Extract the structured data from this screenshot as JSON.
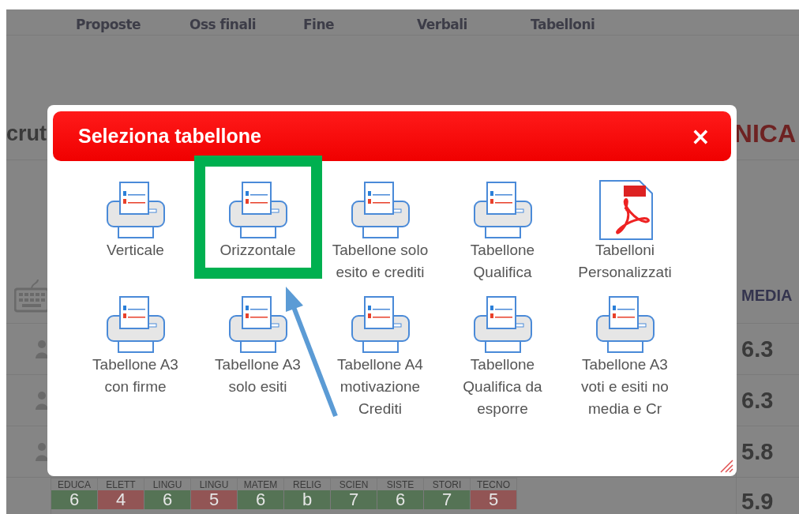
{
  "background": {
    "tabs": [
      {
        "label": "Proposte"
      },
      {
        "label": "Oss finali"
      },
      {
        "label": "Fine"
      },
      {
        "label": "Verbali"
      },
      {
        "label": "Tabelloni"
      }
    ],
    "title_left": "crut",
    "title_right": "NICA",
    "table": {
      "average_header": "MEDIA",
      "rows": [
        {
          "average": "6.3"
        },
        {
          "average": "6.3"
        },
        {
          "average": "5.8"
        }
      ],
      "last_row": {
        "average": "5.9",
        "grades": [
          {
            "subject": "EDUCA",
            "grade": "6",
            "color": "#557355"
          },
          {
            "subject": "ELETT",
            "grade": "4",
            "color": "#925555"
          },
          {
            "subject": "LINGU",
            "grade": "6",
            "color": "#557355"
          },
          {
            "subject": "LINGU",
            "grade": "5",
            "color": "#925555"
          },
          {
            "subject": "MATEM",
            "grade": "6",
            "color": "#557355"
          },
          {
            "subject": "RELIG",
            "grade": "b",
            "color": "#557355"
          },
          {
            "subject": "SCIEN",
            "grade": "7",
            "color": "#557355"
          },
          {
            "subject": "SISTE",
            "grade": "6",
            "color": "#557355"
          },
          {
            "subject": "STORI",
            "grade": "7",
            "color": "#557355"
          },
          {
            "subject": "TECNO",
            "grade": "5",
            "color": "#925555"
          }
        ]
      }
    }
  },
  "dialog": {
    "title": "Seleziona tabellone",
    "close": "×",
    "items": [
      {
        "label": "Verticale",
        "kind": "printer",
        "highlighted": false
      },
      {
        "label": "Orizzontale",
        "kind": "printer",
        "highlighted": true
      },
      {
        "label": "Tabellone solo esito e crediti",
        "kind": "printer",
        "highlighted": false
      },
      {
        "label": "Tabellone Qualifica",
        "kind": "printer",
        "highlighted": false
      },
      {
        "label": "Tabelloni Personalizzati",
        "kind": "pdf",
        "highlighted": false
      },
      {
        "label": "Tabellone A3 con firme",
        "kind": "printer",
        "highlighted": false
      },
      {
        "label": "Tabellone A3 solo esiti",
        "kind": "printer",
        "highlighted": false
      },
      {
        "label": "Tabellone A4 motivazione Crediti",
        "kind": "printer",
        "highlighted": false
      },
      {
        "label": "Tabellone Qualifica da esporre",
        "kind": "printer",
        "highlighted": false
      },
      {
        "label": "Tabellone A3 voti e esiti no media e Cr",
        "kind": "printer",
        "highlighted": false
      }
    ]
  }
}
